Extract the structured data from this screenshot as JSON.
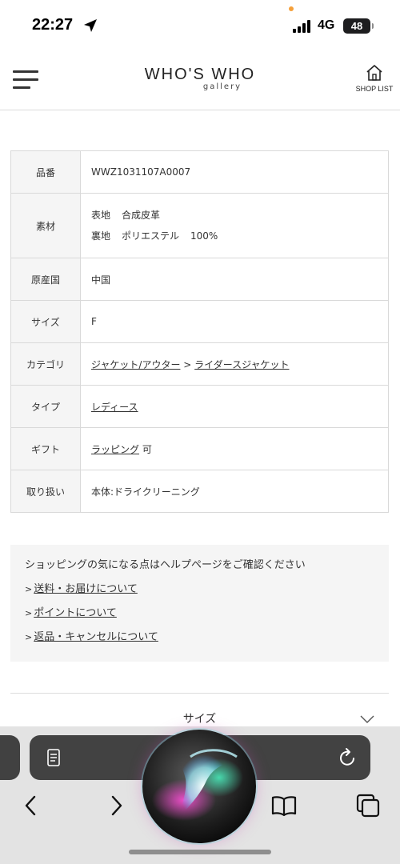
{
  "status_bar": {
    "time": "22:27",
    "network": "4G",
    "battery": "48"
  },
  "header": {
    "logo": "WHO'S WHO",
    "logo_sub": "gallery",
    "shop_list": "SHOP LIST"
  },
  "spec": {
    "product_no_label": "品番",
    "product_no": "WWZ1031107A0007",
    "material_label": "素材",
    "material_outer_label": "表地",
    "material_outer": "合成皮革",
    "material_lining_label": "裏地",
    "material_lining": "ポリエステル",
    "material_lining_pct": "100%",
    "origin_label": "原産国",
    "origin": "中国",
    "size_label": "サイズ",
    "size": "F",
    "category_label": "カテゴリ",
    "category_parent": "ジャケット/アウター",
    "category_sep": ">",
    "category_child": "ライダースジャケット",
    "type_label": "タイプ",
    "type": "レディース",
    "gift_label": "ギフト",
    "gift_link": "ラッピング",
    "gift_suffix": "可",
    "care_label": "取り扱い",
    "care": "本体:ドライクリーニング"
  },
  "help": {
    "title": "ショッピングの気になる点はヘルプページをご確認ください",
    "marker": ">",
    "links": [
      "送料・お届けについて",
      "ポイントについて",
      "返品・キャンセルについて"
    ]
  },
  "accordion": {
    "label": "サイズ"
  },
  "icons": {
    "location": "location-arrow-icon",
    "signal": "signal-bars-icon",
    "menu": "hamburger-menu-icon",
    "shop": "house-icon",
    "chevron": "chevron-down-icon",
    "reader": "reader-mode-icon",
    "reload": "reload-icon",
    "back": "back-icon",
    "forward": "forward-icon",
    "bookmarks": "book-icon",
    "tabs": "tabs-icon",
    "siri": "siri-orb-icon"
  },
  "colors": {
    "text": "#333333",
    "table_header_bg": "#f5f5f5",
    "border": "#d9d9d9",
    "browser_bar": "#424242"
  }
}
